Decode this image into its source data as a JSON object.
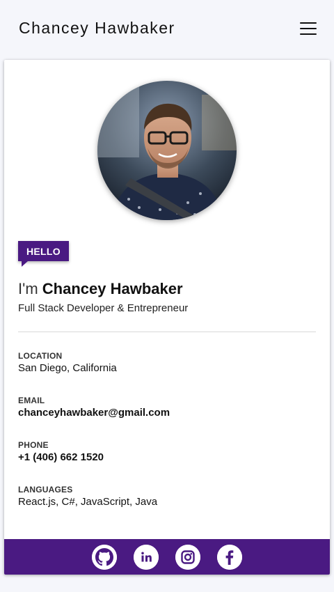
{
  "header": {
    "title": "Chancey Hawbaker",
    "menu_icon": "hamburger-menu-icon"
  },
  "profile": {
    "badge": "HELLO",
    "greeting_prefix": "I'm",
    "name": "Chancey Hawbaker",
    "subtitle": "Full Stack Developer & Entrepreneur",
    "avatar_icon": "profile-photo"
  },
  "info": [
    {
      "label": "LOCATION",
      "value": "San Diego, California"
    },
    {
      "label": "EMAIL",
      "value": "chanceyhawbaker@gmail.com"
    },
    {
      "label": "PHONE",
      "value": "+1 (406) 662 1520"
    },
    {
      "label": "LANGUAGES",
      "value": "React.js, C#, JavaScript, Java"
    }
  ],
  "social": [
    {
      "name": "GitHub",
      "icon": "github-icon"
    },
    {
      "name": "LinkedIn",
      "icon": "linkedin-icon"
    },
    {
      "name": "Instagram",
      "icon": "instagram-icon"
    },
    {
      "name": "Facebook",
      "icon": "facebook-icon"
    }
  ],
  "colors": {
    "accent": "#4a1a82",
    "background": "#f5f6fb",
    "card": "#ffffff"
  }
}
